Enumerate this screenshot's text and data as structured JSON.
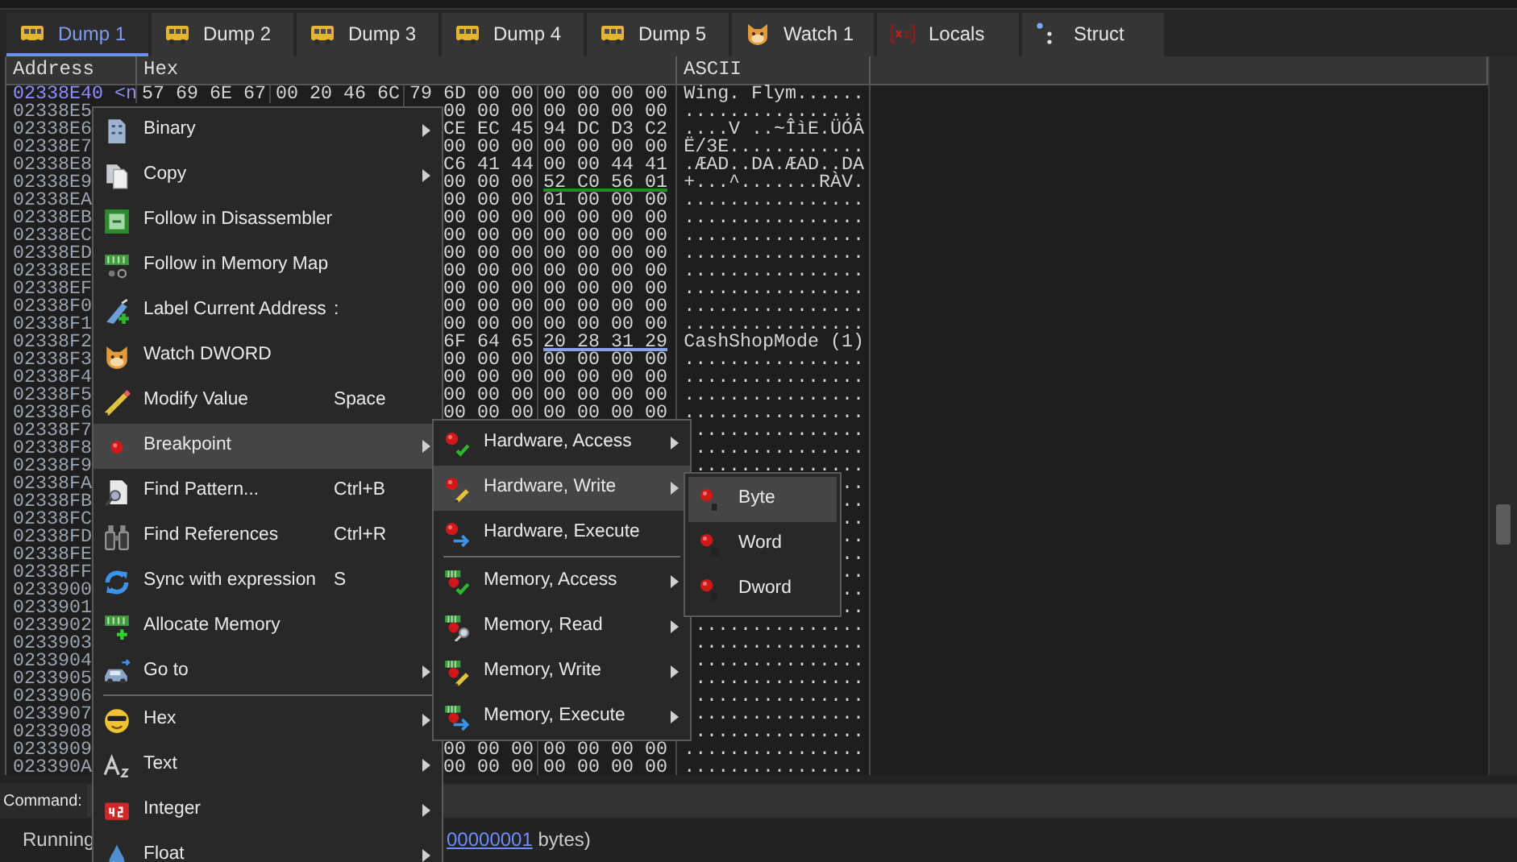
{
  "tabs": [
    {
      "label": "Dump 1",
      "selected": true
    },
    {
      "label": "Dump 2",
      "selected": false
    },
    {
      "label": "Dump 3",
      "selected": false
    },
    {
      "label": "Dump 4",
      "selected": false
    },
    {
      "label": "Dump 5",
      "selected": false
    },
    {
      "label": "Watch 1",
      "selected": false
    },
    {
      "label": "Locals",
      "selected": false
    },
    {
      "label": "Struct",
      "selected": false
    }
  ],
  "dump": {
    "columns": [
      "Address",
      "Hex",
      "ASCII"
    ],
    "rows": [
      {
        "address": "02338E40",
        "selected": true,
        "label": "<n",
        "hex": [
          "57 69 6E 67",
          "00 20 46 6C",
          "79 6D 00 00",
          "00 00 00 00"
        ],
        "ascii": "Wing. Flym......"
      },
      {
        "address": "02338E5",
        "selected": false,
        "hex": [
          "00 00 00",
          "00 00 00 00"
        ],
        "ascii": "................"
      },
      {
        "address": "02338E6",
        "selected": false,
        "hex": [
          "CE EC 45",
          "94 DC D3 C2"
        ],
        "ascii": "....V ..~ÎìE.ÜÓÂ"
      },
      {
        "address": "02338E7",
        "selected": false,
        "hex": [
          "00 00 00",
          "00 00 00 00"
        ],
        "ascii": "Ë/3E............"
      },
      {
        "address": "02338E8",
        "selected": false,
        "hex": [
          "C6 41 44",
          "00 00 44 41"
        ],
        "ascii": ".ÆAD..DA.ÆAD..DA"
      },
      {
        "address": "02338E9",
        "selected": false,
        "hex": [
          "00 00 00",
          "52 C0 56 01"
        ],
        "color": "#1f8f1f",
        "ascii": "+...^.......RÀV."
      },
      {
        "address": "02338EA",
        "selected": false,
        "hex": [
          "00 00 00",
          "01 00 00 00"
        ],
        "ascii": "................"
      },
      {
        "address": "02338EB",
        "selected": false,
        "hex": [
          "00 00 00",
          "00 00 00 00"
        ],
        "ascii": "................"
      },
      {
        "address": "02338EC",
        "selected": false,
        "hex": [
          "00 00 00",
          "00 00 00 00"
        ],
        "ascii": "................"
      },
      {
        "address": "02338ED",
        "selected": false,
        "hex": [
          "00 00 00",
          "00 00 00 00"
        ],
        "ascii": "................"
      },
      {
        "address": "02338EE",
        "selected": false,
        "hex": [
          "00 00 00",
          "00 00 00 00"
        ],
        "ascii": "................"
      },
      {
        "address": "02338EF",
        "selected": false,
        "hex": [
          "00 00 00",
          "00 00 00 00"
        ],
        "ascii": "................"
      },
      {
        "address": "02338F0",
        "selected": false,
        "hex": [
          "00 00 00",
          "00 00 00 00"
        ],
        "ascii": "................"
      },
      {
        "address": "02338F1",
        "selected": false,
        "hex": [
          "00 00 00",
          "00 00 00 00"
        ],
        "ascii": "................"
      },
      {
        "address": "02338F2",
        "selected": false,
        "hex": [
          "6F 64 65",
          "20 28 31 29"
        ],
        "color": "#8f9ff0",
        "ascii": "CashShopMode (1)"
      },
      {
        "address": "02338F3",
        "selected": false,
        "hex": [
          "00 00 00",
          "00 00 00 00"
        ],
        "ascii": "................"
      },
      {
        "address": "02338F4",
        "selected": false,
        "hex": [
          "00 00 00",
          "00 00 00 00"
        ],
        "ascii": "................"
      },
      {
        "address": "02338F5",
        "selected": false,
        "hex": [
          "00 00 00",
          "00 00 00 00"
        ],
        "ascii": "................"
      },
      {
        "address": "02338F6",
        "selected": false,
        "hex": [
          "00 00 00",
          "00 00 00 00"
        ],
        "ascii": "................"
      },
      {
        "address": "02338F7",
        "selected": false,
        "ascii": "..............."
      },
      {
        "address": "02338F8",
        "selected": false,
        "ascii": "..............."
      },
      {
        "address": "02338F9",
        "selected": false,
        "ascii": "..............."
      },
      {
        "address": "02338FA",
        "selected": false,
        "ascii": ".."
      },
      {
        "address": "02338FB",
        "selected": false,
        "ascii": ".."
      },
      {
        "address": "02338FC",
        "selected": false,
        "ascii": ".."
      },
      {
        "address": "02338FD",
        "selected": false,
        "ascii": ".."
      },
      {
        "address": "02338FE",
        "selected": false,
        "ascii": ".."
      },
      {
        "address": "02338FF",
        "selected": false,
        "ascii": ".."
      },
      {
        "address": "0233900",
        "selected": false,
        "ascii": ".."
      },
      {
        "address": "0233901",
        "selected": false,
        "ascii": ".."
      },
      {
        "address": "0233902",
        "selected": false,
        "ascii": "..............."
      },
      {
        "address": "0233903",
        "selected": false,
        "ascii": "..............."
      },
      {
        "address": "0233904",
        "selected": false,
        "ascii": "..............."
      },
      {
        "address": "0233905",
        "selected": false,
        "ascii": "..............."
      },
      {
        "address": "0233906",
        "selected": false,
        "ascii": "..............."
      },
      {
        "address": "0233907",
        "selected": false,
        "ascii": "..............."
      },
      {
        "address": "0233908",
        "selected": false,
        "ascii": "..............."
      },
      {
        "address": "0233909",
        "selected": false,
        "hex": [
          "00 00 00",
          "00 00 00 00"
        ],
        "ascii": "................"
      },
      {
        "address": "023390A",
        "selected": false,
        "hex": [
          "00 00 00",
          "00 00 00 00"
        ],
        "ascii": "................"
      }
    ]
  },
  "command": {
    "label": "Command:"
  },
  "status": {
    "state": "Running",
    "link": "00000001",
    "text": " bytes)"
  },
  "context_menu": {
    "items": [
      {
        "label": "Binary",
        "submenu": true,
        "selected": false
      },
      {
        "label": "Copy",
        "submenu": true,
        "selected": false
      },
      {
        "label": "Follow in Disassembler",
        "submenu": false,
        "selected": false
      },
      {
        "label": "Follow in Memory Map",
        "submenu": false,
        "selected": false
      },
      {
        "label": "Label Current Address",
        "shortcut": ":",
        "submenu": false,
        "selected": false
      },
      {
        "label": "Watch DWORD",
        "submenu": false,
        "selected": false
      },
      {
        "label": "Modify Value",
        "shortcut": "Space",
        "submenu": false,
        "selected": false
      },
      {
        "label": "Breakpoint",
        "submenu": true,
        "selected": true
      },
      {
        "label": "Find Pattern...",
        "shortcut": "Ctrl+B",
        "submenu": false,
        "selected": false
      },
      {
        "label": "Find References",
        "shortcut": "Ctrl+R",
        "submenu": false,
        "selected": false
      },
      {
        "label": "Sync with expression",
        "shortcut": "S",
        "submenu": false,
        "selected": false
      },
      {
        "label": "Allocate Memory",
        "submenu": false,
        "selected": false
      },
      {
        "label": "Go to",
        "submenu": true,
        "selected": false
      },
      {
        "label": "Hex",
        "submenu": true,
        "selected": false,
        "separator_before": true
      },
      {
        "label": "Text",
        "submenu": true,
        "selected": false
      },
      {
        "label": "Integer",
        "submenu": true,
        "selected": false
      },
      {
        "label": "Float",
        "submenu": true,
        "selected": false
      }
    ]
  },
  "breakpoint_menu": {
    "items": [
      {
        "label": "Hardware, Access",
        "submenu": true,
        "selected": false
      },
      {
        "label": "Hardware, Write",
        "submenu": true,
        "selected": true
      },
      {
        "label": "Hardware, Execute",
        "submenu": false,
        "selected": false
      },
      {
        "label": "Memory, Access",
        "submenu": true,
        "selected": false,
        "separator_before": true
      },
      {
        "label": "Memory, Read",
        "submenu": true,
        "selected": false
      },
      {
        "label": "Memory, Write",
        "submenu": true,
        "selected": false
      },
      {
        "label": "Memory, Execute",
        "submenu": true,
        "selected": false
      }
    ]
  },
  "size_menu": {
    "items": [
      {
        "label": "Byte",
        "submenu": false,
        "selected": true
      },
      {
        "label": "Word",
        "submenu": false,
        "selected": false
      },
      {
        "label": "Dword",
        "submenu": false,
        "selected": false
      }
    ]
  }
}
